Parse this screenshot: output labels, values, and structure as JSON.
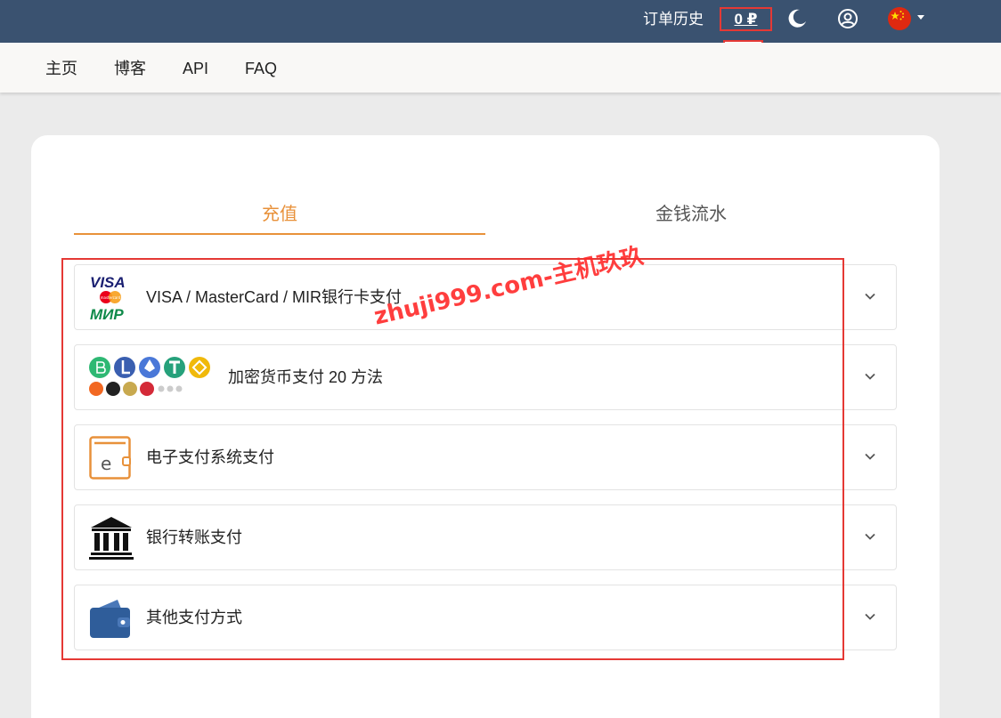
{
  "header": {
    "order_history": "订单历史",
    "balance": "0 ₽",
    "tooltip": "充值",
    "icons": {
      "theme": "moon-icon",
      "account": "user-circle-icon",
      "language": "china-flag-icon"
    }
  },
  "nav": {
    "items": [
      "主页",
      "博客",
      "API",
      "FAQ"
    ]
  },
  "tabs": [
    {
      "label": "充值",
      "active": true
    },
    {
      "label": "金钱流水",
      "active": false
    }
  ],
  "payment_methods": [
    {
      "label": "VISA / MasterCard / MIR银行卡支付",
      "icon": "card-brands-icon",
      "logo_text": {
        "visa": "VISA",
        "mastercard": "mastercard",
        "mir": "МИР"
      }
    },
    {
      "label": "加密货币支付 20 方法",
      "icon": "crypto-coins-icon"
    },
    {
      "label": "电子支付系统支付",
      "icon": "e-wallet-icon",
      "logo_text": "e"
    },
    {
      "label": "银行转账支付",
      "icon": "bank-icon"
    },
    {
      "label": "其他支付方式",
      "icon": "wallet-icon"
    }
  ],
  "watermark": "zhuji999.com-主机玖玖",
  "colors": {
    "topbar": "#3a5270",
    "accent": "#e8913a",
    "annotation": "#e53935"
  }
}
